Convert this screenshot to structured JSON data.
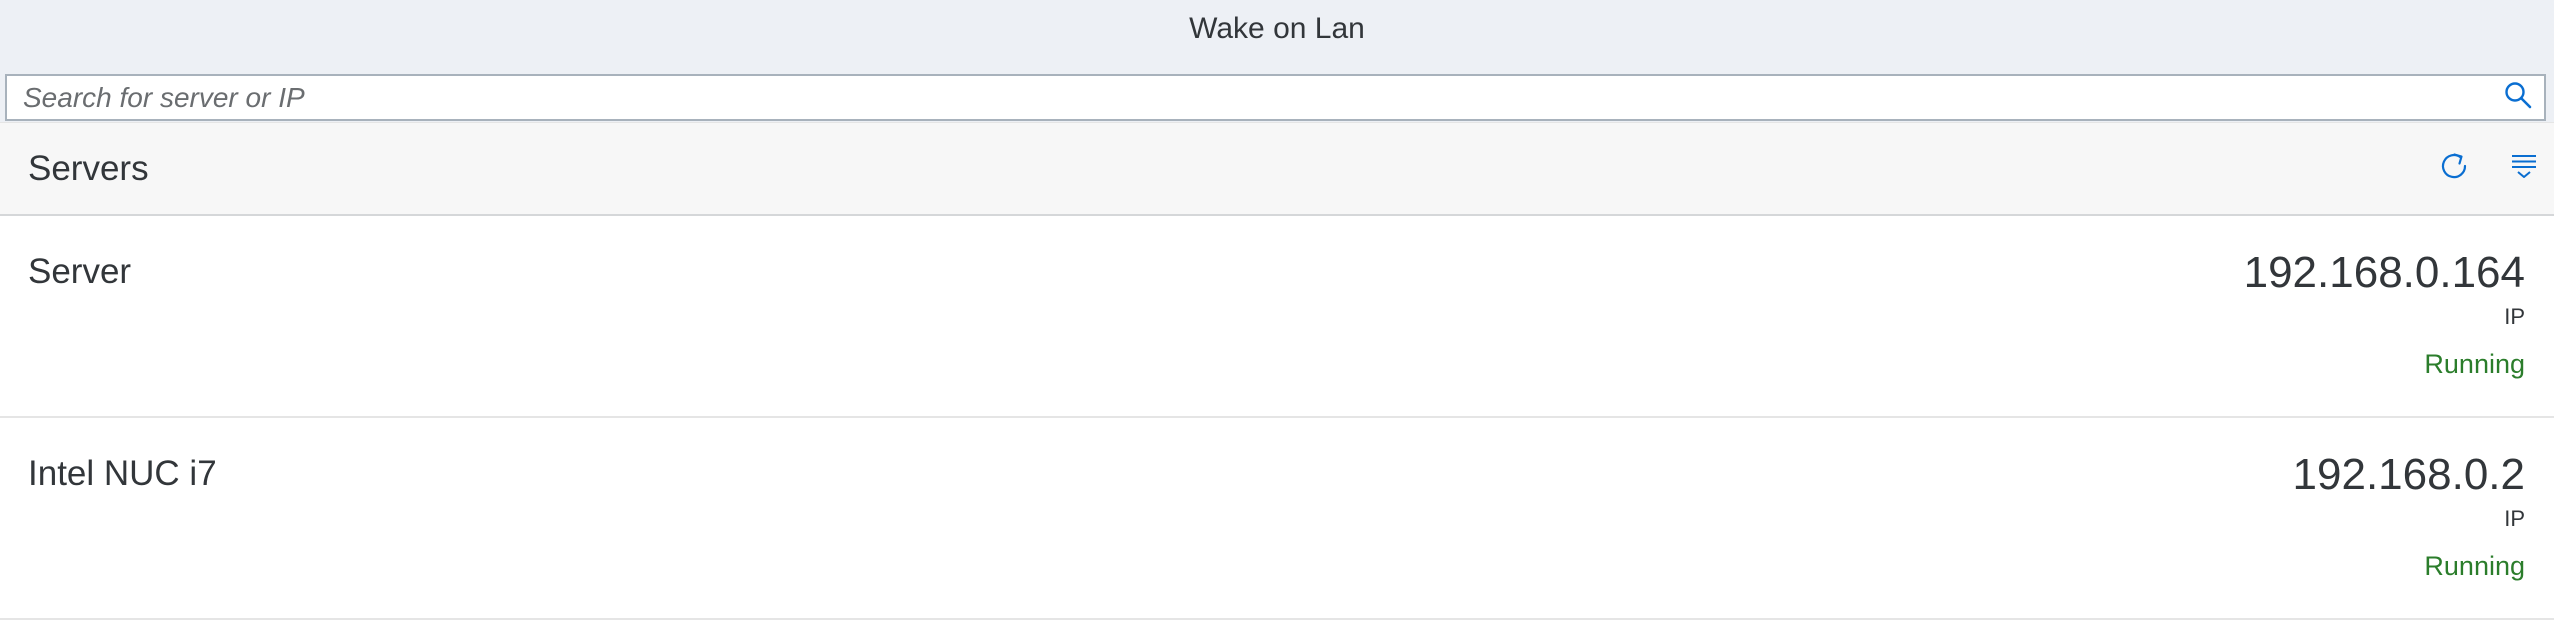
{
  "app": {
    "title": "Wake on Lan"
  },
  "search": {
    "placeholder": "Search for server or IP",
    "value": "",
    "icon": "search-icon"
  },
  "list": {
    "title": "Servers",
    "actions": [
      {
        "name": "refresh",
        "icon": "refresh-icon"
      },
      {
        "name": "sort",
        "icon": "sort-list-icon"
      }
    ],
    "items": [
      {
        "name": "Server",
        "ip": "192.168.0.164",
        "unit": "IP",
        "status": "Running"
      },
      {
        "name": "Intel NUC i7",
        "ip": "192.168.0.2",
        "unit": "IP",
        "status": "Running"
      }
    ]
  },
  "colors": {
    "shell_background": "#edf0f5",
    "status_positive": "#2b7d2b",
    "icon_accent": "#0a6ed1"
  }
}
